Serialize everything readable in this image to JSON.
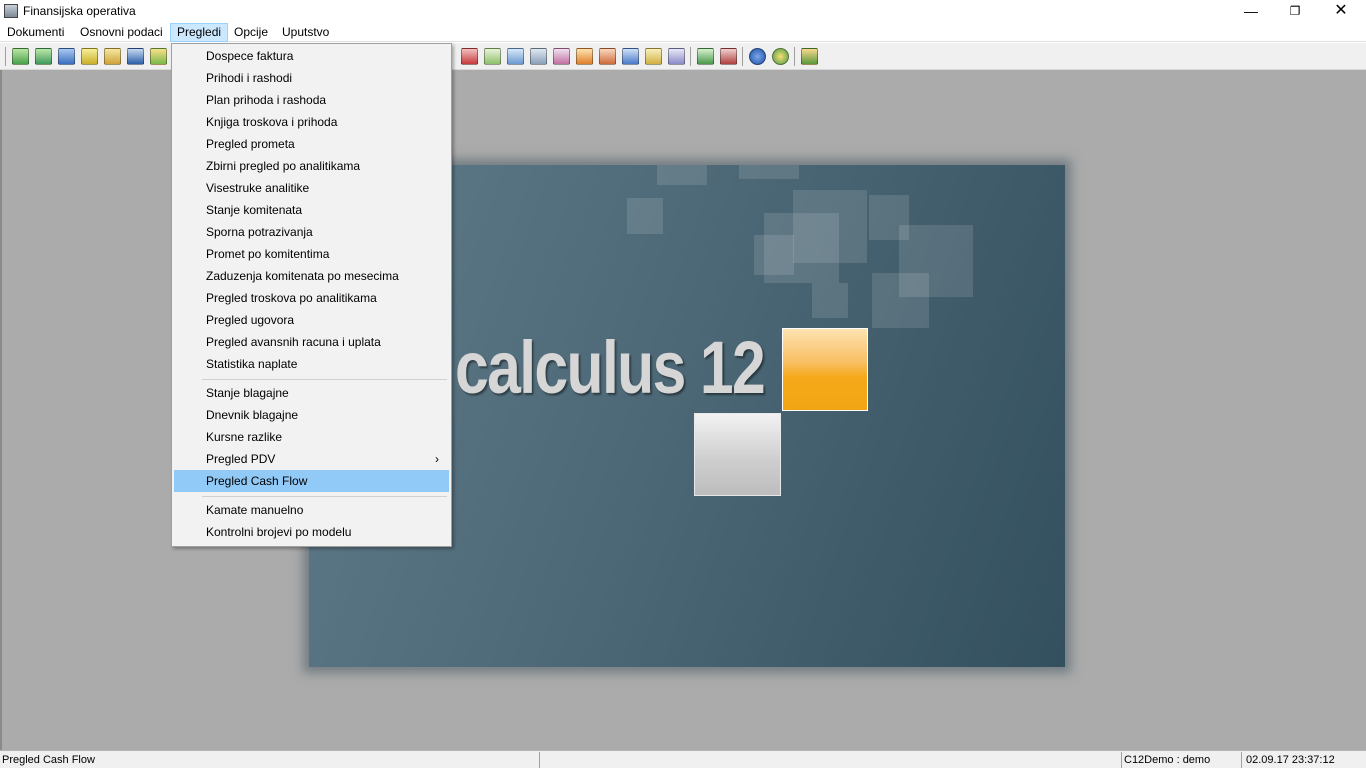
{
  "window": {
    "title": "Finansijska operativa",
    "minimize_glyph": "—",
    "maximize_glyph": "❐",
    "close_glyph": "✕"
  },
  "menubar": {
    "items": [
      "Dokumenti",
      "Osnovni podaci",
      "Pregledi",
      "Opcije",
      "Uputstvo"
    ],
    "active": "Pregledi"
  },
  "toolbar": {
    "icons": [
      "toolbar-icon-1",
      "toolbar-icon-2",
      "toolbar-icon-3",
      "toolbar-icon-4",
      "toolbar-icon-5",
      "toolbar-icon-6",
      "toolbar-icon-7",
      "toolbar-icon-8",
      "toolbar-icon-9",
      "toolbar-icon-10",
      "toolbar-icon-11",
      "toolbar-icon-12",
      "toolbar-icon-13",
      "toolbar-icon-14",
      "toolbar-icon-15",
      "toolbar-icon-16",
      "toolbar-icon-17",
      "toolbar-icon-18",
      "toolbar-icon-19",
      "toolbar-icon-20",
      "help-icon",
      "info-icon",
      "exit-icon"
    ]
  },
  "splash": {
    "logo_text": "calculus 12",
    "accent_orange": "#f5a91a",
    "background": "#4d6876"
  },
  "dropdown": {
    "group1": [
      "Dospece faktura",
      "Prihodi i rashodi",
      "Plan prihoda i rashoda",
      "Knjiga troskova i prihoda",
      "Pregled prometa",
      "Zbirni pregled po analitikama",
      "Visestruke analitike",
      "Stanje komitenata",
      "Sporna potrazivanja",
      "Promet po komitentima",
      "Zaduzenja komitenata po mesecima",
      "Pregled troskova po analitikama",
      "Pregled ugovora",
      "Pregled avansnih racuna i uplata",
      "Statistika naplate"
    ],
    "group2": [
      "Stanje blagajne",
      "Dnevnik blagajne",
      "Kursne razlike",
      "Pregled PDV",
      "Pregled Cash Flow"
    ],
    "group3": [
      "Kamate manuelno",
      "Kontrolni brojevi po modelu"
    ],
    "submenu_arrow": "›",
    "highlighted": "Pregled Cash Flow",
    "highlight_color": "#91c9f7"
  },
  "statusbar": {
    "message": "Pregled Cash Flow",
    "user": "C12Demo : demo",
    "datetime": "02.09.17 23:37:12"
  }
}
